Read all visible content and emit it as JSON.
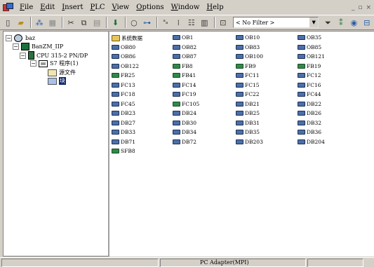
{
  "menu": [
    "File",
    "Edit",
    "Insert",
    "PLC",
    "View",
    "Options",
    "Window",
    "Help"
  ],
  "window_controls": [
    "_",
    "&#x2B1A;",
    "×"
  ],
  "filter": {
    "value": "< No Filter >"
  },
  "tree": [
    {
      "label": "baz",
      "expander": "−",
      "icon": "project",
      "selected": false
    },
    {
      "label": "BanZM_IIP",
      "expander": "−",
      "icon": "station",
      "selected": false
    },
    {
      "label": "CPU 315-2 PN/DP",
      "expander": "−",
      "icon": "cpu",
      "selected": false
    },
    {
      "label": "S7 程序(1)",
      "expander": "−",
      "icon": "prog",
      "selected": false
    },
    {
      "label": "源文件",
      "expander": "",
      "icon": "folder",
      "selected": false
    },
    {
      "label": "块",
      "expander": "",
      "icon": "folder-blue",
      "selected": true
    }
  ],
  "blocks": [
    [
      "系统数据",
      "OB1",
      "OB10",
      "OB35"
    ],
    [
      "OB80",
      "OB82",
      "OB83",
      "OB85"
    ],
    [
      "OB86",
      "OB87",
      "OB100",
      "OB121"
    ],
    [
      "OB122",
      "FB8",
      "FB9",
      "FB19"
    ],
    [
      "FB25",
      "FB41",
      "FC11",
      "FC12"
    ],
    [
      "FC13",
      "FC14",
      "FC15",
      "FC16"
    ],
    [
      "FC18",
      "FC19",
      "FC22",
      "FC44"
    ],
    [
      "FC45",
      "FC105",
      "DB21",
      "DB22"
    ],
    [
      "DB23",
      "DB24",
      "DB25",
      "DB26"
    ],
    [
      "DB27",
      "DB30",
      "DB31",
      "DB32"
    ],
    [
      "DB33",
      "DB34",
      "DB35",
      "DB36"
    ],
    [
      "DB71",
      "DB72",
      "DB203",
      "DB204"
    ],
    [
      "SFB8"
    ]
  ],
  "status": {
    "text": "PC Adapter(MPI)"
  }
}
